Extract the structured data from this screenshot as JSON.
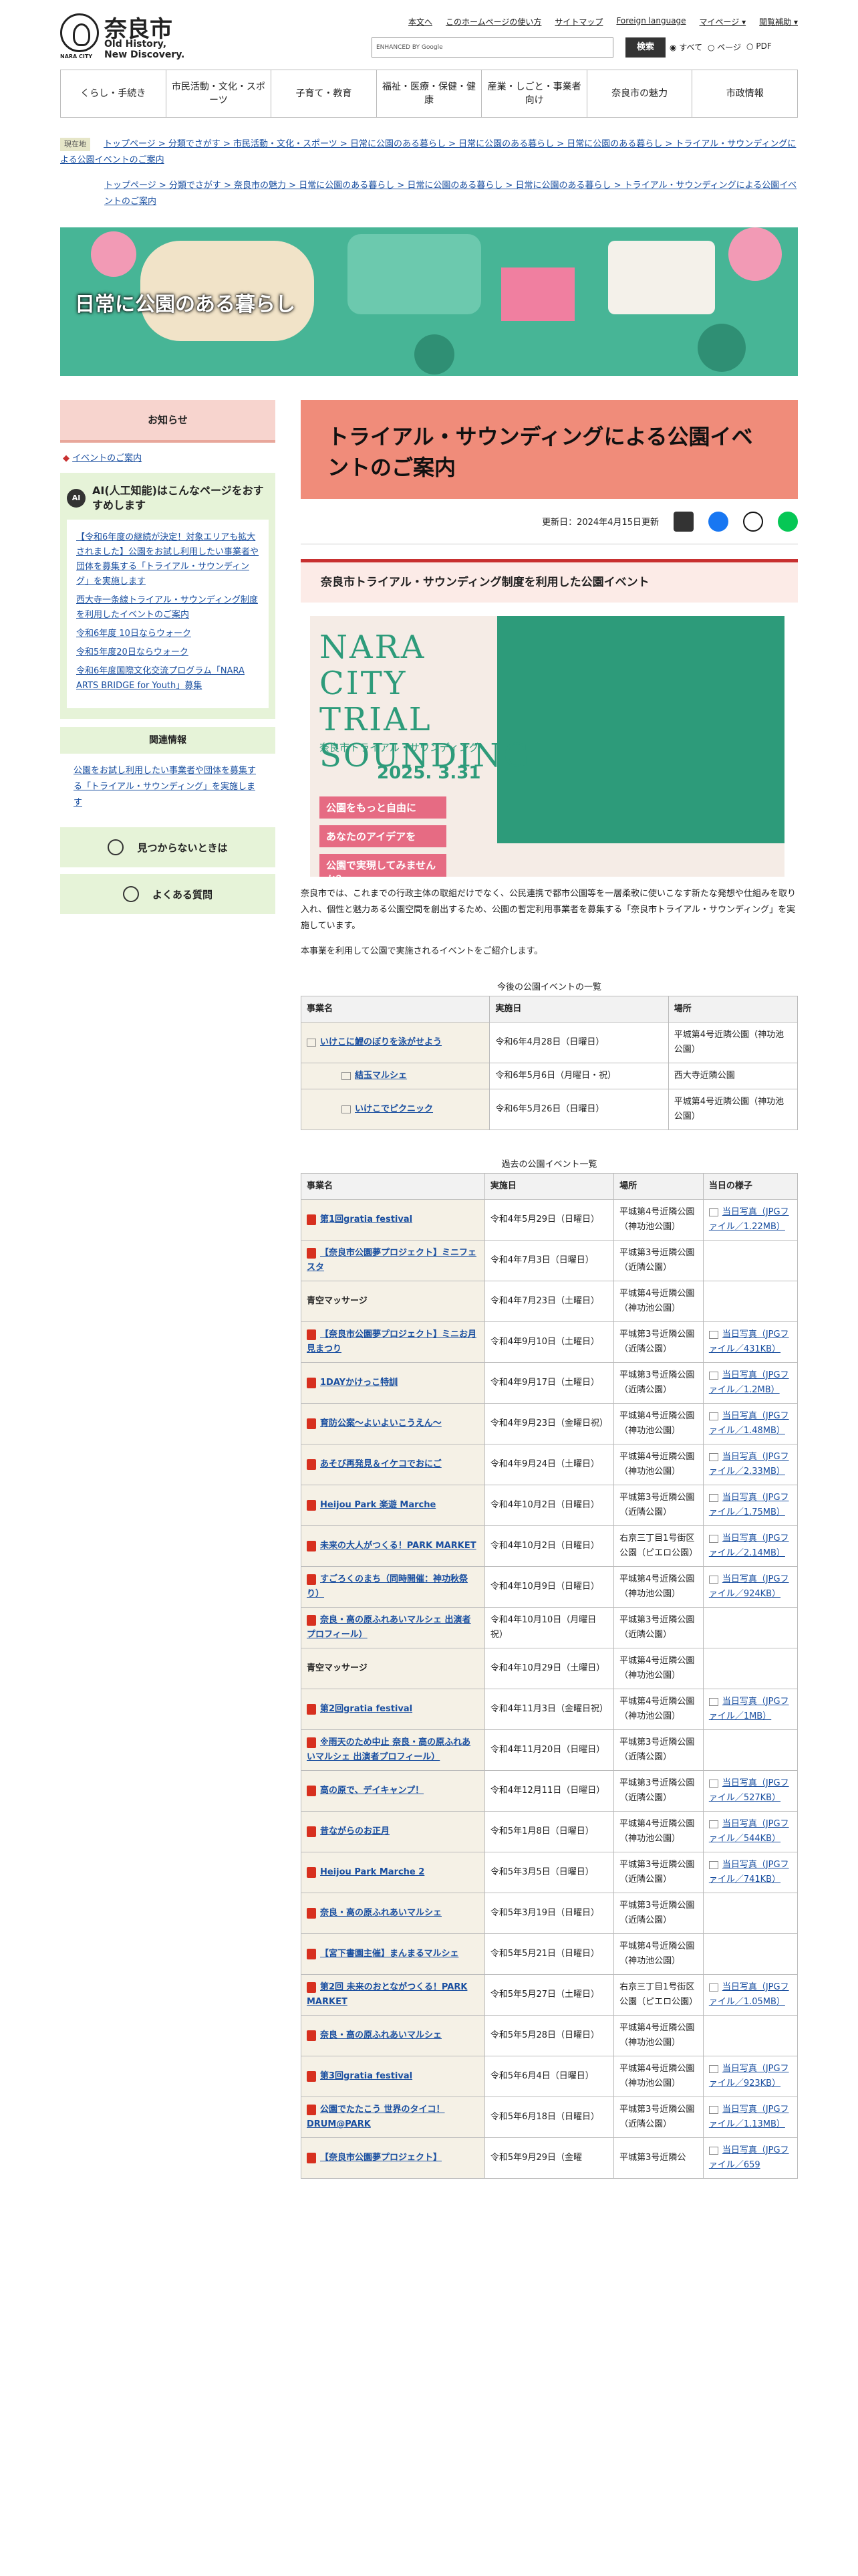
{
  "header": {
    "logo_name": "奈良市",
    "logo_sub": "Old History, New Discovery.",
    "logo_en": "NARA CITY",
    "util_links": [
      "本文へ",
      "このホームページの使い方",
      "サイトマップ",
      "Foreign language",
      "マイページ ▾",
      "閲覧補助 ▾"
    ],
    "search_label": "ENHANCED BY Google",
    "search_button": "検索",
    "scope": [
      "すべて",
      "ページ",
      "PDF"
    ]
  },
  "nav": [
    "くらし・手続き",
    "市民活動・文化・スポーツ",
    "子育て・教育",
    "福祉・医療・保健・健康",
    "産業・しごと・事業者向け",
    "奈良市の魅力",
    "市政情報"
  ],
  "breadcrumb": {
    "tag": "現在地",
    "trail1": "トップページ > 分類でさがす > 市民活動・文化・スポーツ > 日常に公園のある暮らし > 日常に公園のある暮らし > 日常に公園のある暮らし > トライアル・サウンディングによる公園イベントのご案内",
    "trail2": "トップページ > 分類でさがす > 奈良市の魅力 > 日常に公園のある暮らし > 日常に公園のある暮らし > 日常に公園のある暮らし > トライアル・サウンディングによる公園イベントのご案内"
  },
  "hero_title": "日常に公園のある暮らし",
  "side": {
    "notice_title": "お知らせ",
    "notice_link": "イベントのご案内",
    "ai_badge": "AI",
    "ai_title": "AI(人工知能)はこんなページをおすすめします",
    "ai_links": [
      "【令和6年度の継続が決定！対象エリアも拡大されました】公園をお試し利用したい事業者や団体を募集する「トライアル・サウンディング」を実施します",
      "西大寺一条線トライアル・サウンディング制度を利用したイベントのご案内",
      "令和6年度 10日ならウォーク",
      "令和5年度20日ならウォーク",
      "令和6年度国際文化交流プログラム「NARA ARTS BRIDGE for Youth」募集"
    ],
    "related_title": "関連情報",
    "related_link": "公園をお試し利用したい事業者や団体を募集する「トライアル・サウンディング」を実施します",
    "btn_help": "見つからないときは",
    "btn_faq": "よくある質問"
  },
  "main": {
    "title": "トライアル・サウンディングによる公園イベントのご案内",
    "updated": "更新日：2024年4月15日更新",
    "h2": "奈良市トライアル・サウンディング制度を利用した公園イベント",
    "banner_title": "NARA CITY TRIAL SOUNDING",
    "banner_sub": "奈良市トライアル・サウンディング",
    "banner_date": "2025. 3.31",
    "banner_pink": [
      "公園をもっと自由に",
      "あなたのアイデアを",
      "公園で実現してみませんか？"
    ],
    "intro": "奈良市では、これまでの行政主体の取組だけでなく、公民連携で都市公園等を一層柔軟に使いこなす新たな発想や仕組みを取り入れ、個性と魅力ある公園空間を創出するため、公園の暫定利用事業者を募集する「奈良市トライアル・サウンディング」を実施しています。",
    "intro_link": "奈良市トライアル・サウンディング",
    "intro2": "本事業を利用して公園で実施されるイベントをご紹介します。",
    "upcoming_caption": "今後の公園イベントの一覧",
    "upcoming_headers": [
      "事業名",
      "実施日",
      "場所"
    ],
    "upcoming": [
      {
        "name": "いけこに鯉のぼりを泳がせよう",
        "date": "令和6年4月28日（日曜日）",
        "place": "平城第4号近隣公園（神功池公園）"
      },
      {
        "name": "結玉マルシェ",
        "date": "令和6年5月6日（月曜日・祝）",
        "place": "西大寺近隣公園"
      },
      {
        "name": "いけこでピクニック",
        "date": "令和6年5月26日（日曜日）",
        "place": "平城第4号近隣公園（神功池公園）"
      }
    ],
    "past_caption": "過去の公園イベント一覧",
    "past_headers": [
      "事業名",
      "実施日",
      "場所",
      "当日の様子"
    ],
    "past": [
      {
        "name": "第1回gratia festival",
        "date": "令和4年5月29日（日曜日）",
        "place": "平城第4号近隣公園（神功池公園）",
        "photo": "当日写真（JPGファイル／1.22MB）"
      },
      {
        "name": "【奈良市公園夢プロジェクト】ミニフェスタ",
        "date": "令和4年7月3日（日曜日）",
        "place": "平城第3号近隣公園（近隣公園）",
        "photo": ""
      },
      {
        "name": "青空マッサージ",
        "date": "令和4年7月23日（土曜日）",
        "place": "平城第4号近隣公園（神功池公園）",
        "photo": ""
      },
      {
        "name": "【奈良市公園夢プロジェクト】ミニお月見まつり",
        "date": "令和4年9月10日（土曜日）",
        "place": "平城第3号近隣公園（近隣公園）",
        "photo": "当日写真（JPGファイル／431KB）"
      },
      {
        "name": "1DAYかけっこ特訓",
        "date": "令和4年9月17日（土曜日）",
        "place": "平城第3号近隣公園（近隣公園）",
        "photo": "当日写真（JPGファイル／1.2MB）"
      },
      {
        "name": "育防公案～よいよいこうえん～",
        "date": "令和4年9月23日（金曜日祝）",
        "place": "平城第4号近隣公園（神功池公園）",
        "photo": "当日写真（JPGファイル／1.48MB）"
      },
      {
        "name": "あそび再発見＆イケコでおにご",
        "date": "令和4年9月24日（土曜日）",
        "place": "平城第4号近隣公園（神功池公園）",
        "photo": "当日写真（JPGファイル／2.33MB）"
      },
      {
        "name": "Heijou Park 楽遊 Marche",
        "date": "令和4年10月2日（日曜日）",
        "place": "平城第3号近隣公園（近隣公園）",
        "photo": "当日写真（JPGファイル／1.75MB）"
      },
      {
        "name": "未来の大人がつくる！PARK MARKET",
        "date": "令和4年10月2日（日曜日）",
        "place": "右京三丁目1号街区公園（ピエロ公園）",
        "photo": "当日写真（JPGファイル／2.14MB）"
      },
      {
        "name": "すごろくのまち（同時開催：神功秋祭り）",
        "date": "令和4年10月9日（日曜日）",
        "place": "平城第4号近隣公園（神功池公園）",
        "photo": "当日写真（JPGファイル／924KB）"
      },
      {
        "name": "奈良・高の原ふれあいマルシェ 出演者プロフィール）",
        "date": "令和4年10月10日（月曜日祝）",
        "place": "平城第3号近隣公園（近隣公園）",
        "photo": ""
      },
      {
        "name": "青空マッサージ",
        "date": "令和4年10月29日（土曜日）",
        "place": "平城第4号近隣公園（神功池公園）",
        "photo": ""
      },
      {
        "name": "第2回gratia festival",
        "date": "令和4年11月3日（金曜日祝）",
        "place": "平城第4号近隣公園（神功池公園）",
        "photo": "当日写真（JPGファイル／1MB）"
      },
      {
        "name": "※雨天のため中止 奈良・高の原ふれあいマルシェ 出演者プロフィール）",
        "date": "令和4年11月20日（日曜日）",
        "place": "平城第3号近隣公園（近隣公園）",
        "photo": ""
      },
      {
        "name": "高の原で、デイキャンプ！",
        "date": "令和4年12月11日（日曜日）",
        "place": "平城第3号近隣公園（近隣公園）",
        "photo": "当日写真（JPGファイル／527KB）"
      },
      {
        "name": "昔ながらのお正月",
        "date": "令和5年1月8日（日曜日）",
        "place": "平城第4号近隣公園（神功池公園）",
        "photo": "当日写真（JPGファイル／544KB）"
      },
      {
        "name": "Heijou Park Marche 2",
        "date": "令和5年3月5日（日曜日）",
        "place": "平城第3号近隣公園（近隣公園）",
        "photo": "当日写真（JPGファイル／741KB）"
      },
      {
        "name": "奈良・高の原ふれあいマルシェ",
        "date": "令和5年3月19日（日曜日）",
        "place": "平城第3号近隣公園（近隣公園）",
        "photo": ""
      },
      {
        "name": "【宮下書園主催】まんまるマルシェ",
        "date": "令和5年5月21日（日曜日）",
        "place": "平城第4号近隣公園（神功池公園）",
        "photo": ""
      },
      {
        "name": "第2回 未来のおとながつくる！PARK MARKET",
        "date": "令和5年5月27日（土曜日）",
        "place": "右京三丁目1号街区公園（ピエロ公園）",
        "photo": "当日写真（JPGファイル／1.05MB）"
      },
      {
        "name": "奈良・高の原ふれあいマルシェ",
        "date": "令和5年5月28日（日曜日）",
        "place": "平城第4号近隣公園（神功池公園）",
        "photo": ""
      },
      {
        "name": "第3回gratia festival",
        "date": "令和5年6月4日（日曜日）",
        "place": "平城第4号近隣公園（神功池公園）",
        "photo": "当日写真（JPGファイル／923KB）"
      },
      {
        "name": "公園でたたこう 世界のタイコ！DRUM@PARK",
        "date": "令和5年6月18日（日曜日）",
        "place": "平城第3号近隣公園（近隣公園）",
        "photo": "当日写真（JPGファイル／1.13MB）"
      },
      {
        "name": "【奈良市公園夢プロジェクト】",
        "date": "令和5年9月29日（金曜",
        "place": "平城第3号近隣公",
        "photo": "当日写真（JPGファイル／659"
      }
    ]
  }
}
